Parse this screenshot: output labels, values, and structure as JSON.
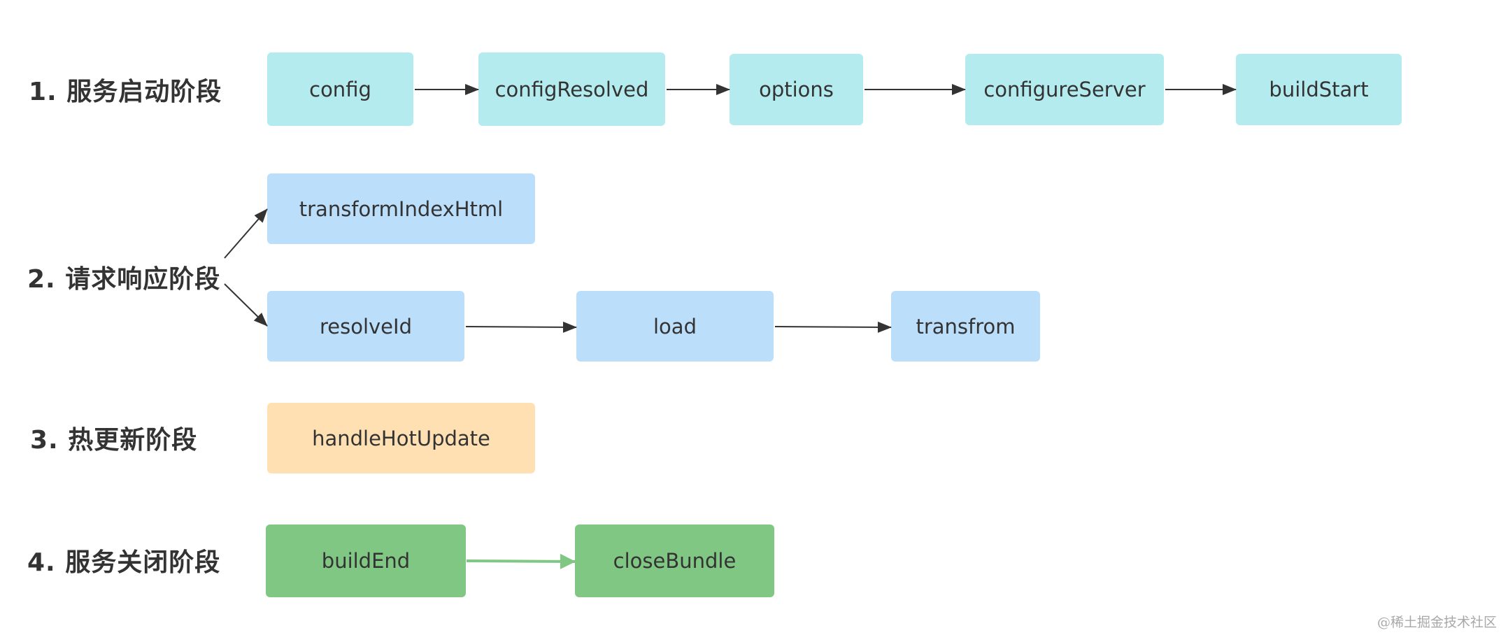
{
  "stages": [
    {
      "label": "1. 服务启动阶段",
      "color": "#b3ebef",
      "nodes": [
        "config",
        "configResolved",
        "options",
        "configureServer",
        "buildStart"
      ]
    },
    {
      "label": "2. 请求响应阶段",
      "color": "#bbdefb",
      "branches": [
        {
          "nodes": [
            "transformIndexHtml"
          ]
        },
        {
          "nodes": [
            "resolveId",
            "load",
            "transfrom"
          ]
        }
      ]
    },
    {
      "label": "3. 热更新阶段",
      "color": "#ffe0b2",
      "nodes": [
        "handleHotUpdate"
      ]
    },
    {
      "label": "4. 服务关闭阶段",
      "color": "#81c784",
      "nodes": [
        "buildEnd",
        "closeBundle"
      ]
    }
  ],
  "edges": [
    [
      "config",
      "configResolved"
    ],
    [
      "configResolved",
      "options"
    ],
    [
      "options",
      "configureServer"
    ],
    [
      "configureServer",
      "buildStart"
    ],
    [
      "stage2",
      "transformIndexHtml"
    ],
    [
      "stage2",
      "resolveId"
    ],
    [
      "resolveId",
      "load"
    ],
    [
      "load",
      "transfrom"
    ],
    [
      "buildEnd",
      "closeBundle"
    ]
  ],
  "arrow_color": "#333333",
  "green_arrow_color": "#81c784",
  "watermark": "@稀土掘金技术社区"
}
